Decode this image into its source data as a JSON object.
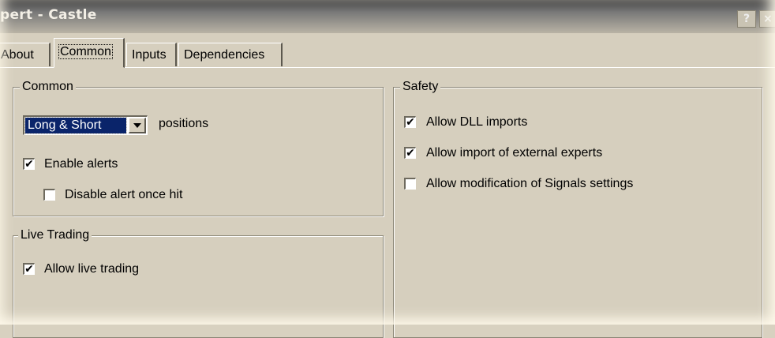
{
  "window": {
    "title": "pert - Castle",
    "help_label": "?",
    "close_label": "×"
  },
  "tabs": [
    {
      "label": "About",
      "active": false
    },
    {
      "label": "Common",
      "active": true
    },
    {
      "label": "Inputs",
      "active": false
    },
    {
      "label": "Dependencies",
      "active": false
    }
  ],
  "common_group": {
    "title": "Common",
    "positions_select": {
      "value": "Long & Short"
    },
    "positions_label": "positions",
    "enable_alerts": {
      "label": "Enable alerts",
      "checked": true
    },
    "disable_alert": {
      "label": "Disable alert once hit",
      "checked": false
    }
  },
  "live_trading_group": {
    "title": "Live Trading",
    "allow_live": {
      "label": "Allow live trading",
      "checked": true
    }
  },
  "safety_group": {
    "title": "Safety",
    "allow_dll": {
      "label": "Allow DLL imports",
      "checked": true
    },
    "allow_external": {
      "label": "Allow import of external experts",
      "checked": true
    },
    "allow_signals": {
      "label": "Allow modification of Signals settings",
      "checked": false
    }
  },
  "colors": {
    "dialog_bg": "#d6cfbe",
    "selection": "#0a246a"
  },
  "icons": {
    "check": "✔",
    "dropdown": "chevron-down-icon"
  }
}
